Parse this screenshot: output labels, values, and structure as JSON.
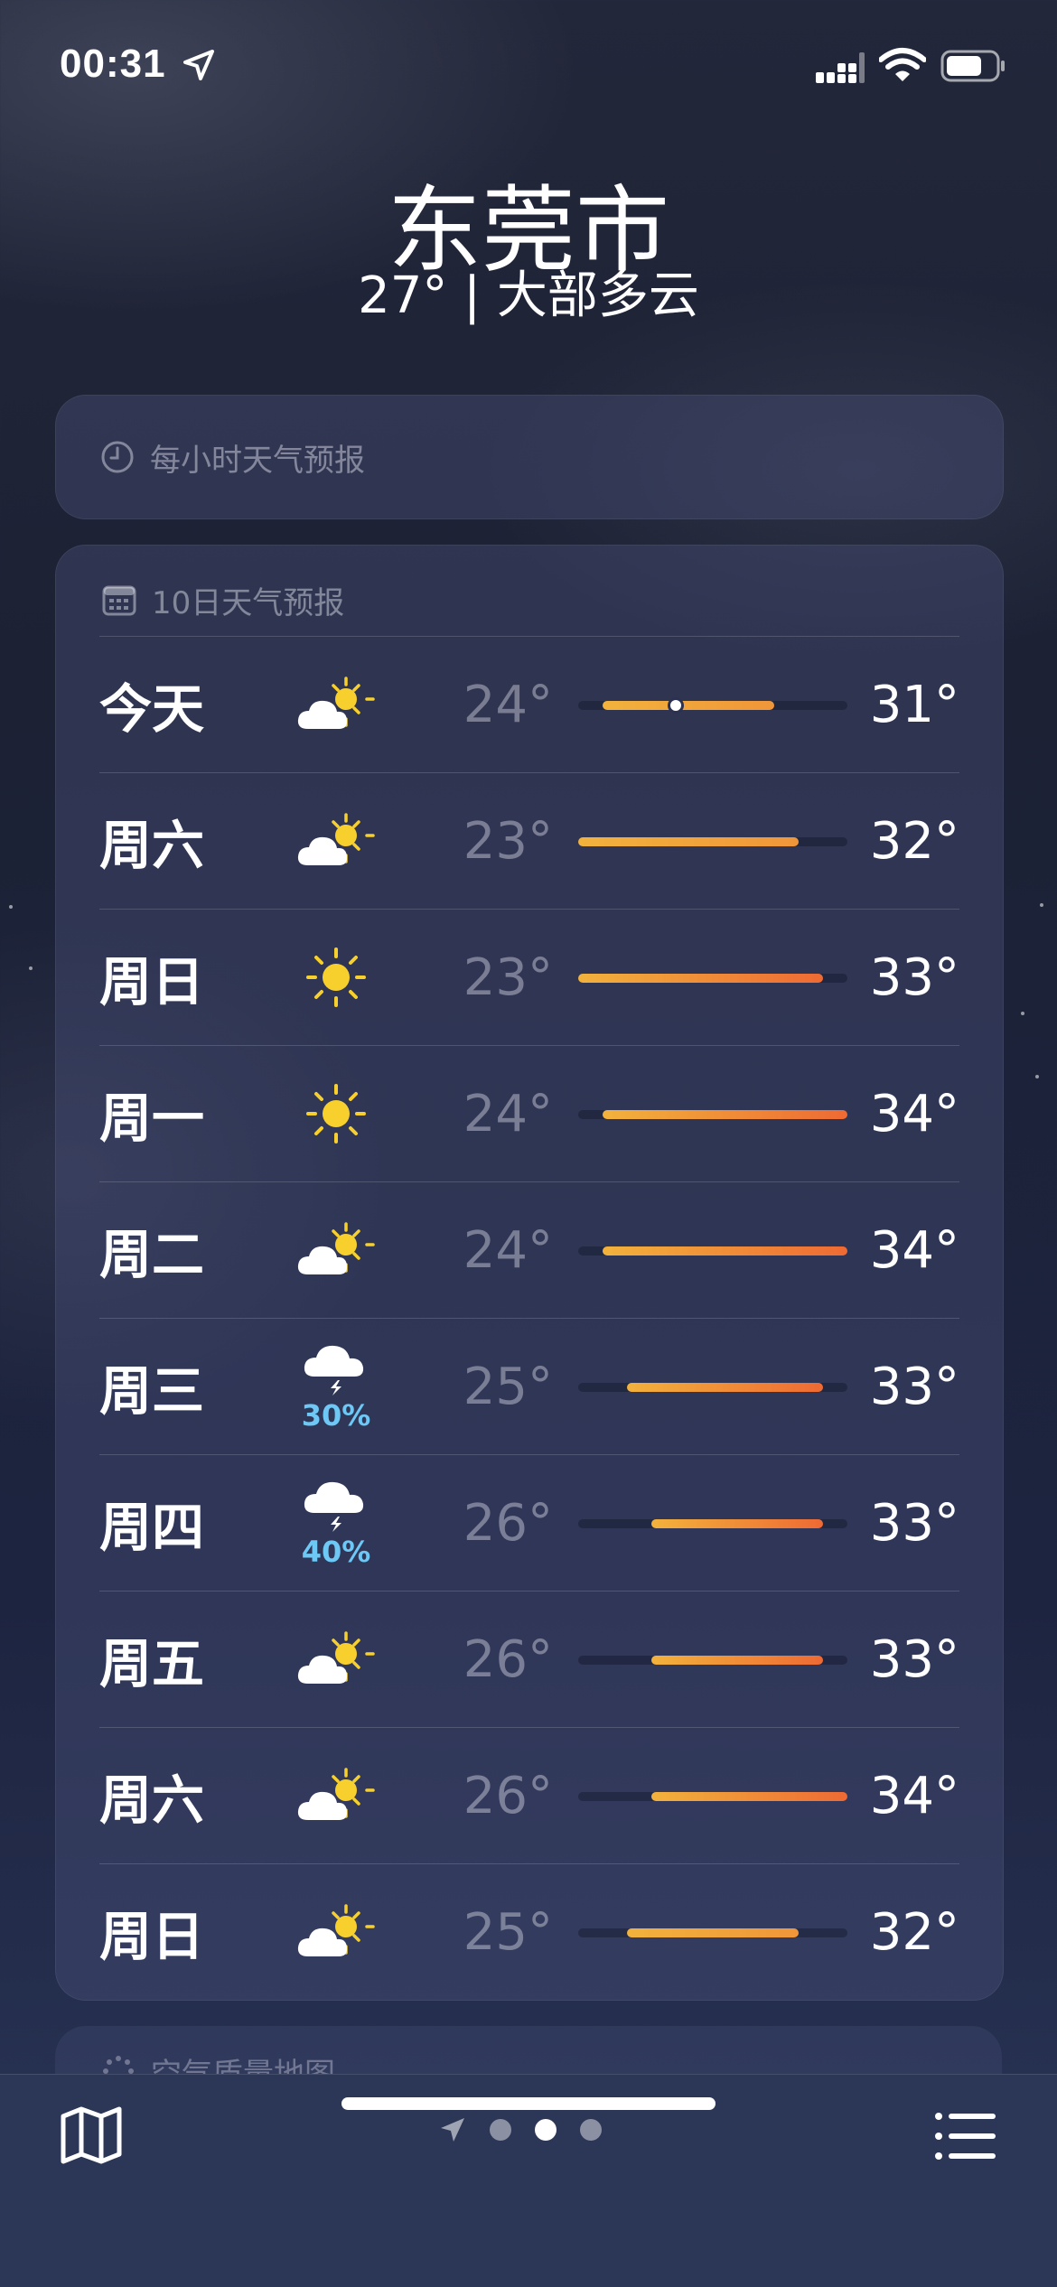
{
  "status_bar": {
    "time": "00:31",
    "icons": [
      "location-arrow-icon",
      "cellular-signal-icon",
      "wifi-icon",
      "battery-icon"
    ]
  },
  "header": {
    "city": "东莞市",
    "summary": "27° | 大部多云"
  },
  "hourly_card": {
    "icon": "clock-icon",
    "title": "每小时天气预报"
  },
  "tenday_card": {
    "icon": "calendar-icon",
    "title": "10日天气预报",
    "range_min": 23,
    "range_max": 34,
    "current_temp": 27,
    "days": [
      {
        "day": "今天",
        "icon": "partly-cloudy-icon",
        "precip": "",
        "low": "24°",
        "high": "31°",
        "low_value": 24,
        "high_value": 31
      },
      {
        "day": "周六",
        "icon": "partly-cloudy-icon",
        "precip": "",
        "low": "23°",
        "high": "32°",
        "low_value": 23,
        "high_value": 32
      },
      {
        "day": "周日",
        "icon": "sun-icon",
        "precip": "",
        "low": "23°",
        "high": "33°",
        "low_value": 23,
        "high_value": 33
      },
      {
        "day": "周一",
        "icon": "sun-icon",
        "precip": "",
        "low": "24°",
        "high": "34°",
        "low_value": 24,
        "high_value": 34
      },
      {
        "day": "周二",
        "icon": "partly-cloudy-icon",
        "precip": "",
        "low": "24°",
        "high": "34°",
        "low_value": 24,
        "high_value": 34
      },
      {
        "day": "周三",
        "icon": "thunderstorm-icon",
        "precip": "30%",
        "low": "25°",
        "high": "33°",
        "low_value": 25,
        "high_value": 33
      },
      {
        "day": "周四",
        "icon": "thunderstorm-icon",
        "precip": "40%",
        "low": "26°",
        "high": "33°",
        "low_value": 26,
        "high_value": 33
      },
      {
        "day": "周五",
        "icon": "partly-cloudy-icon",
        "precip": "",
        "low": "26°",
        "high": "33°",
        "low_value": 26,
        "high_value": 33
      },
      {
        "day": "周六",
        "icon": "partly-cloudy-icon",
        "precip": "",
        "low": "26°",
        "high": "34°",
        "low_value": 26,
        "high_value": 34
      },
      {
        "day": "周日",
        "icon": "partly-cloudy-icon",
        "precip": "",
        "low": "25°",
        "high": "32°",
        "low_value": 25,
        "high_value": 32
      }
    ]
  },
  "air_quality_card": {
    "icon": "air-quality-icon",
    "title": "空气质量地图"
  },
  "toolbar": {
    "map_icon": "map-icon",
    "list_icon": "list-icon",
    "page_count": 3,
    "active_page": 1
  },
  "colors": {
    "precip": "#6ec8f5",
    "bar_low": "#f2b23c",
    "bar_high": "#ee6a34"
  }
}
